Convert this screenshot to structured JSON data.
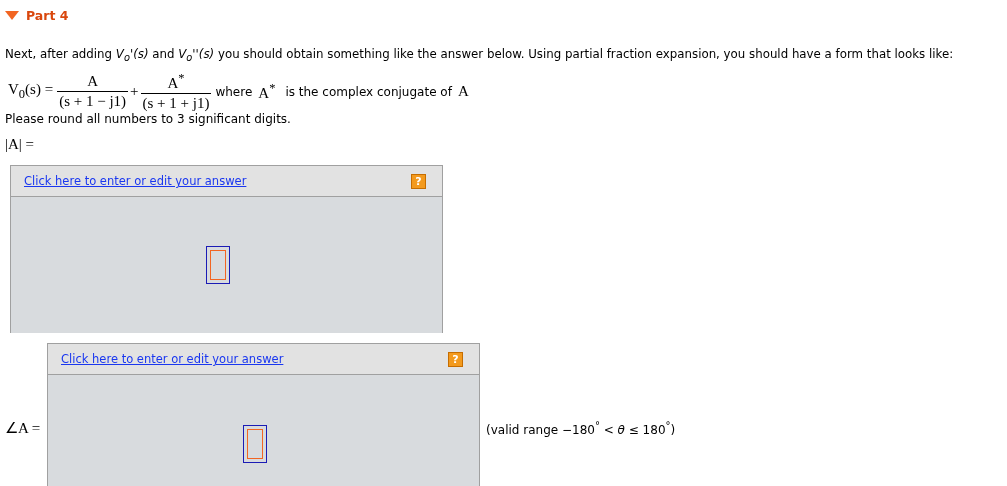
{
  "part": {
    "title": "Part 4",
    "expanded": true
  },
  "intro": "Next, after adding *V$_{o}$'(s)* and *V$_{o}$''(s)* you should obtain something like the answer below. Using partial fraction expansion, you should have a form that looks like:",
  "equation": {
    "lhs": "V$_{0}$(s) =",
    "terms": [
      {
        "numerator": "A",
        "denominator": "(s + 1 − j1)"
      },
      {
        "operator": "+",
        "numerator": "A$^{*}$",
        "denominator": "(s + 1 + j1)"
      }
    ],
    "note_prefix": "where",
    "note_symbol": "A$^{*}$",
    "note_text": "is the complex conjugate of",
    "note_end": "A"
  },
  "instruction": "Please round all numbers to 3 significant digits.",
  "answers": [
    {
      "kind": "stacked",
      "label": "|A| =",
      "link": "Click here to enter or edit your answer",
      "help": "?"
    },
    {
      "kind": "inline",
      "label": "∠A =",
      "link": "Click here to enter or edit your answer",
      "help": "?",
      "note": "(valid range −180$^{°}$ < *θ* ≤ 180$^{°}$)"
    }
  ]
}
